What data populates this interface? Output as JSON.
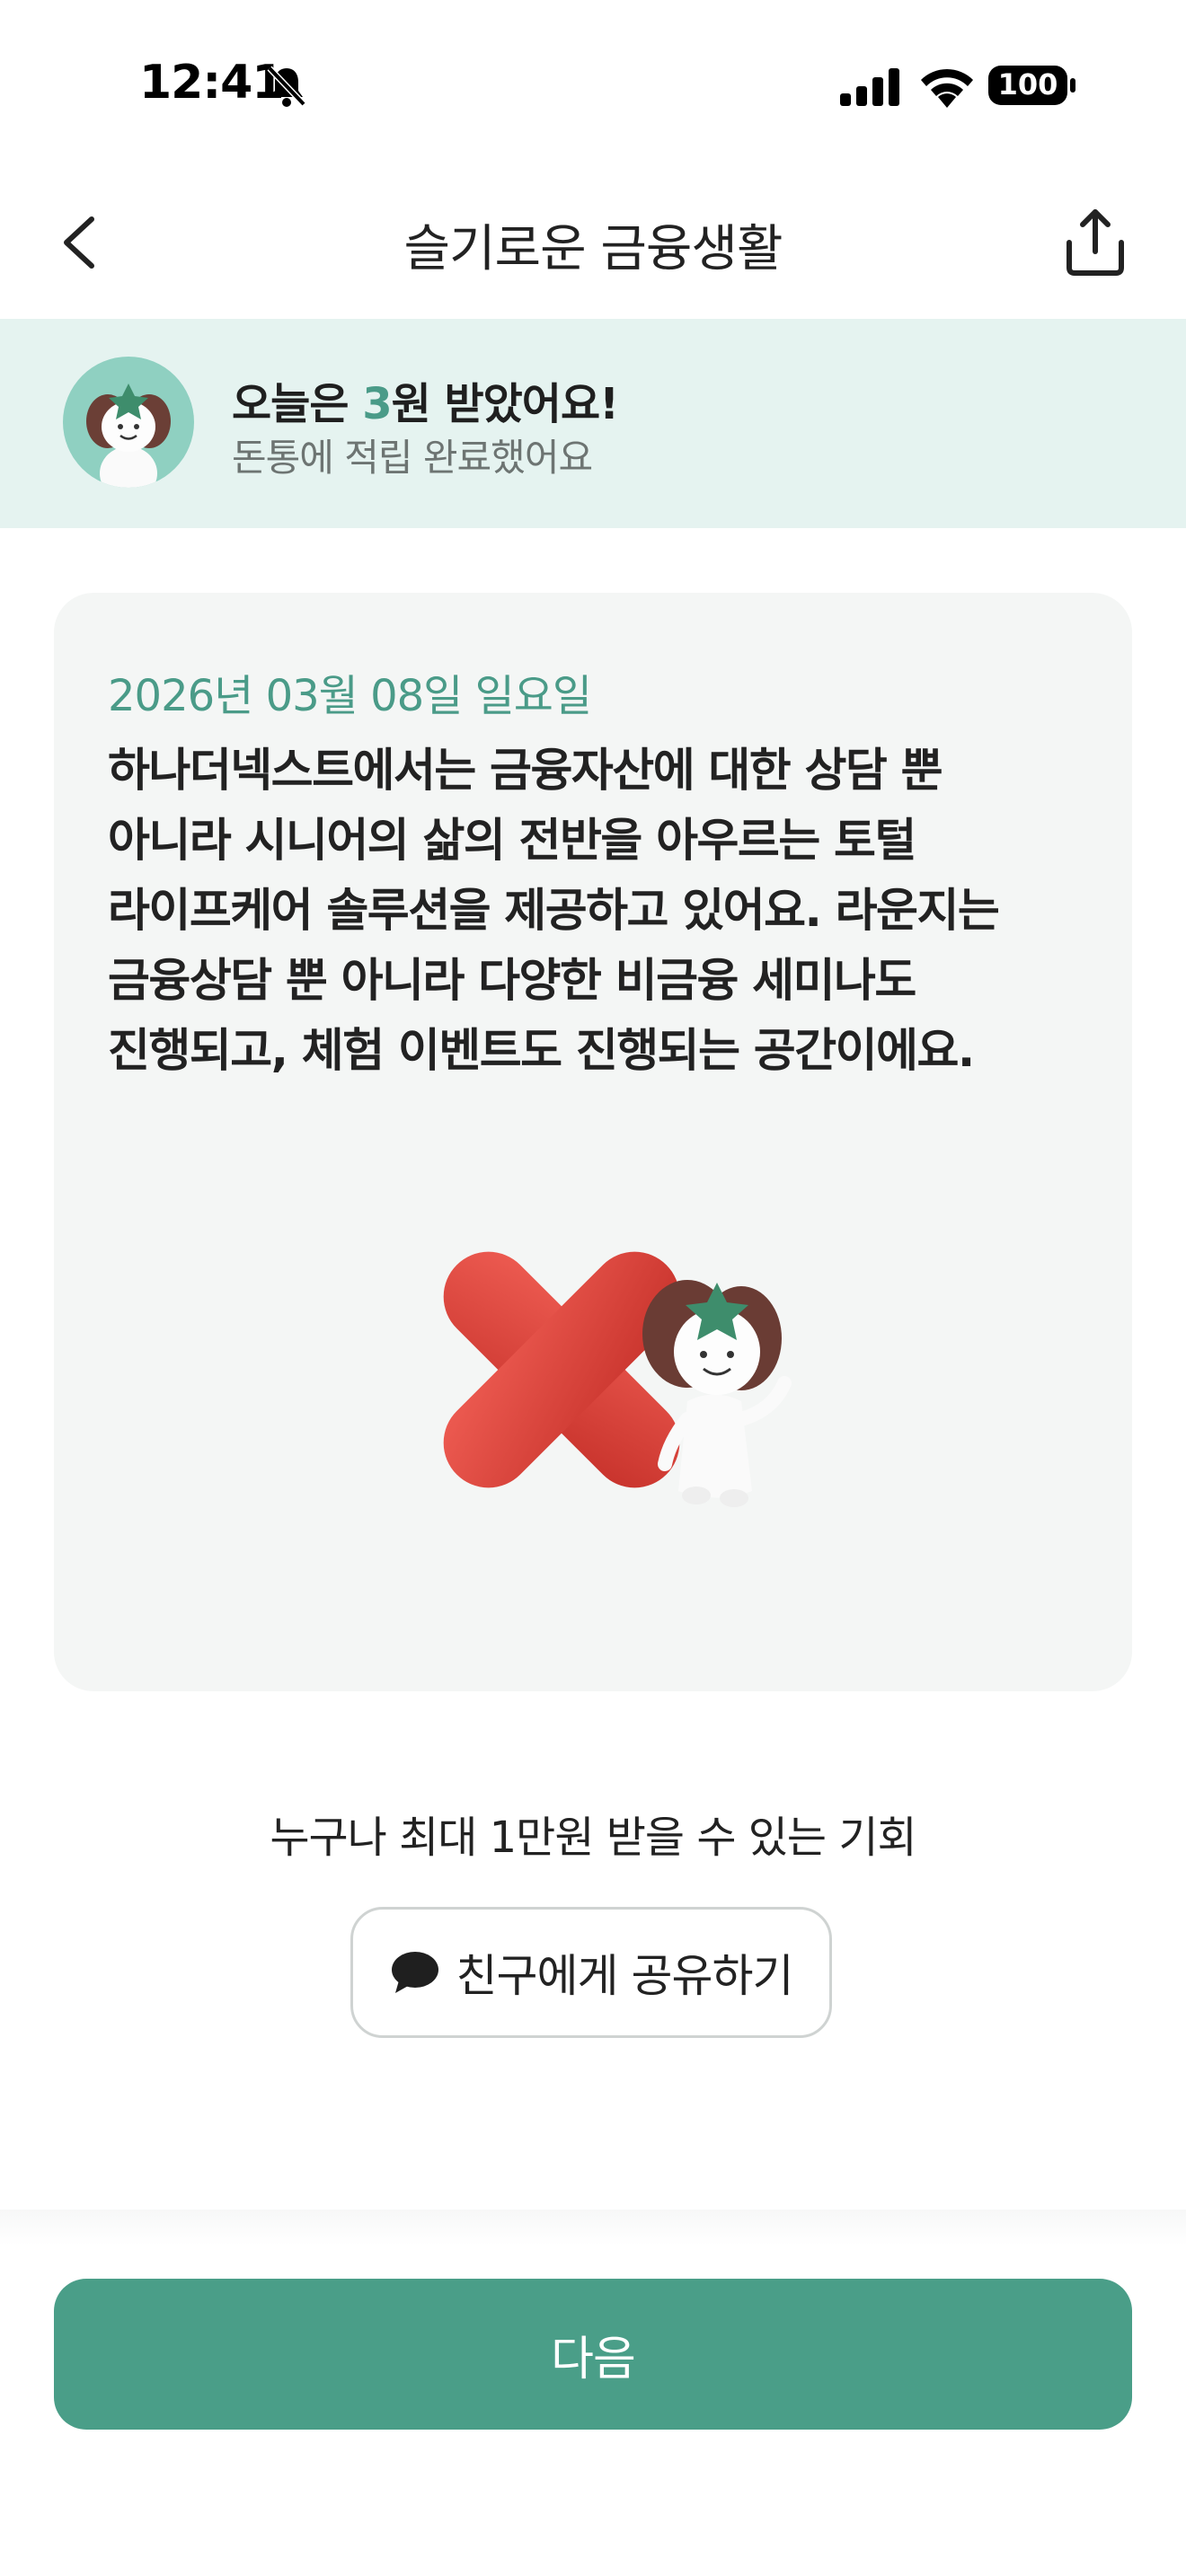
{
  "status_bar": {
    "time": "12:41",
    "battery": "100",
    "icons": [
      "bell-slash-icon",
      "signal-icon",
      "wifi-icon",
      "battery-icon"
    ]
  },
  "header": {
    "title": "슬기로운 금융생활",
    "back_icon": "chevron-left-icon",
    "share_icon": "share-upload-icon"
  },
  "banner": {
    "prefix": "오늘은 ",
    "amount": "3",
    "suffix": "원 받았어요!",
    "subtitle": "돈통에 적립 완료했어요"
  },
  "card": {
    "date": "2026년 03월 08일 일요일",
    "lines": [
      "하나더넥스트에서는 금융자산에 대한 상담 뿐",
      "아니라 시니어의 삶의 전반을 아우르는 토털",
      "라이프케어 솔루션을 제공하고 있어요. 라운지는",
      "금융상담 뿐 아니라 다양한 비금융 세미나도",
      "진행되고, 체험 이벤트도 진행되는 공간이에요."
    ],
    "answer_icon": "red-x-icon"
  },
  "promo": {
    "text": "누구나 최대 1만원 받을 수 있는 기회",
    "share_button_label": "친구에게 공유하기",
    "share_button_icon": "chat-bubble-icon"
  },
  "footer": {
    "next_label": "다음"
  },
  "colors": {
    "accent": "#4a9e88",
    "banner_bg": "#e5f3f0",
    "card_bg": "#f4f6f5",
    "x_red": "#d9443b"
  }
}
